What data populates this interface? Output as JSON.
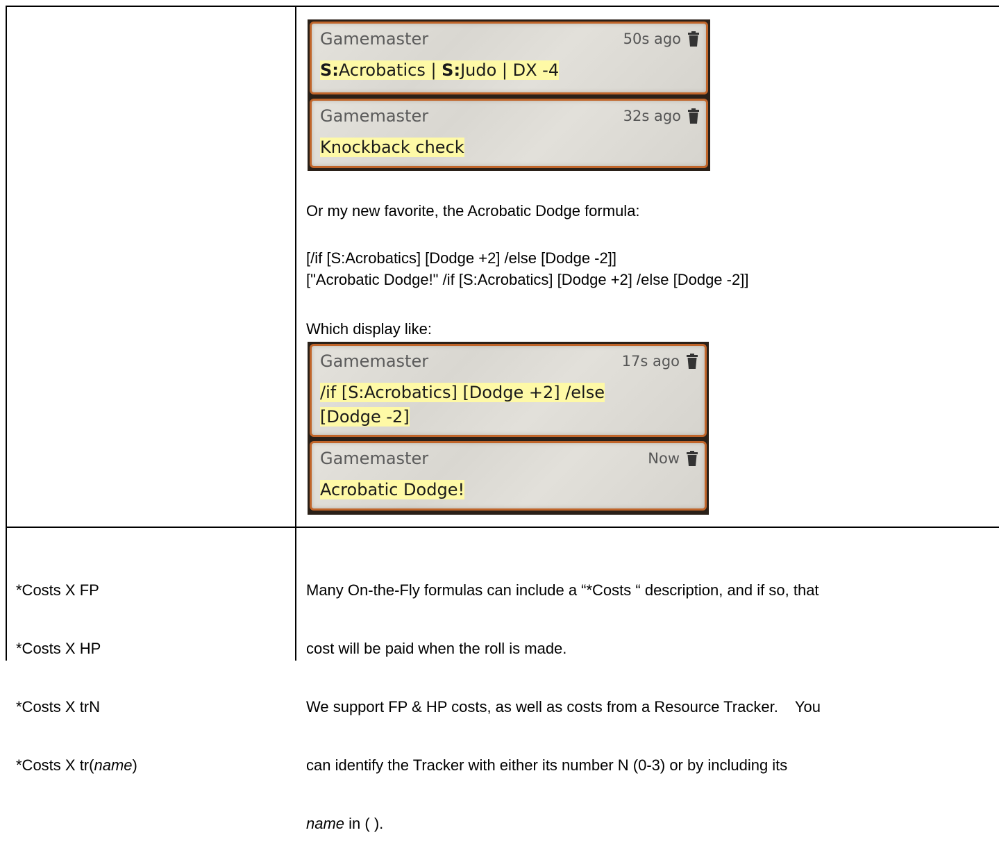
{
  "row1": {
    "chat_top": [
      {
        "sender": "Gamemaster",
        "time": "50s ago",
        "skill_prefix_1": "S:",
        "skill_name_1": "Acrobatics | ",
        "skill_prefix_2": "S:",
        "skill_name_2": "Judo | DX -4"
      },
      {
        "sender": "Gamemaster",
        "time": "32s ago",
        "body": "Knockback check"
      }
    ],
    "intro": "Or my new favorite, the Acrobatic Dodge formula:",
    "formula_1": "[/if [S:Acrobatics] [Dodge +2] /else [Dodge -2]]",
    "formula_2": "[\"Acrobatic Dodge!\" /if [S:Acrobatics] [Dodge +2] /else [Dodge -2]]",
    "display_label": "Which display like:",
    "chat_bottom": [
      {
        "sender": "Gamemaster",
        "time": "17s ago",
        "body_line_1": "/if [S:Acrobatics] [Dodge +2] /else",
        "body_line_2": "[Dodge -2]"
      },
      {
        "sender": "Gamemaster",
        "time": "Now",
        "body": "Acrobatic Dodge!"
      }
    ]
  },
  "row2": {
    "left_lines": [
      "*Costs X FP",
      "*Costs X HP",
      "*Costs X trN"
    ],
    "left_line_4_prefix": "*Costs X tr(",
    "left_line_4_italic": "name",
    "left_line_4_suffix": ")",
    "right_line_1": "Many On-the-Fly formulas can include a “*Costs “ description, and if so, that",
    "right_line_2": "cost will be paid when the roll is made.",
    "right_line_3": "We support FP & HP costs, as well as costs from a Resource Tracker.    You",
    "right_line_4": "can identify the Tracker with either its number N (0-3) or by including its",
    "right_line_5_italic": "name",
    "right_line_5_suffix": " in ( )."
  },
  "icons": {
    "delete": "trash-icon"
  },
  "colors": {
    "card_border": "#c0652a",
    "highlight": "#fef9a6",
    "card_frame": "#2a2018"
  }
}
